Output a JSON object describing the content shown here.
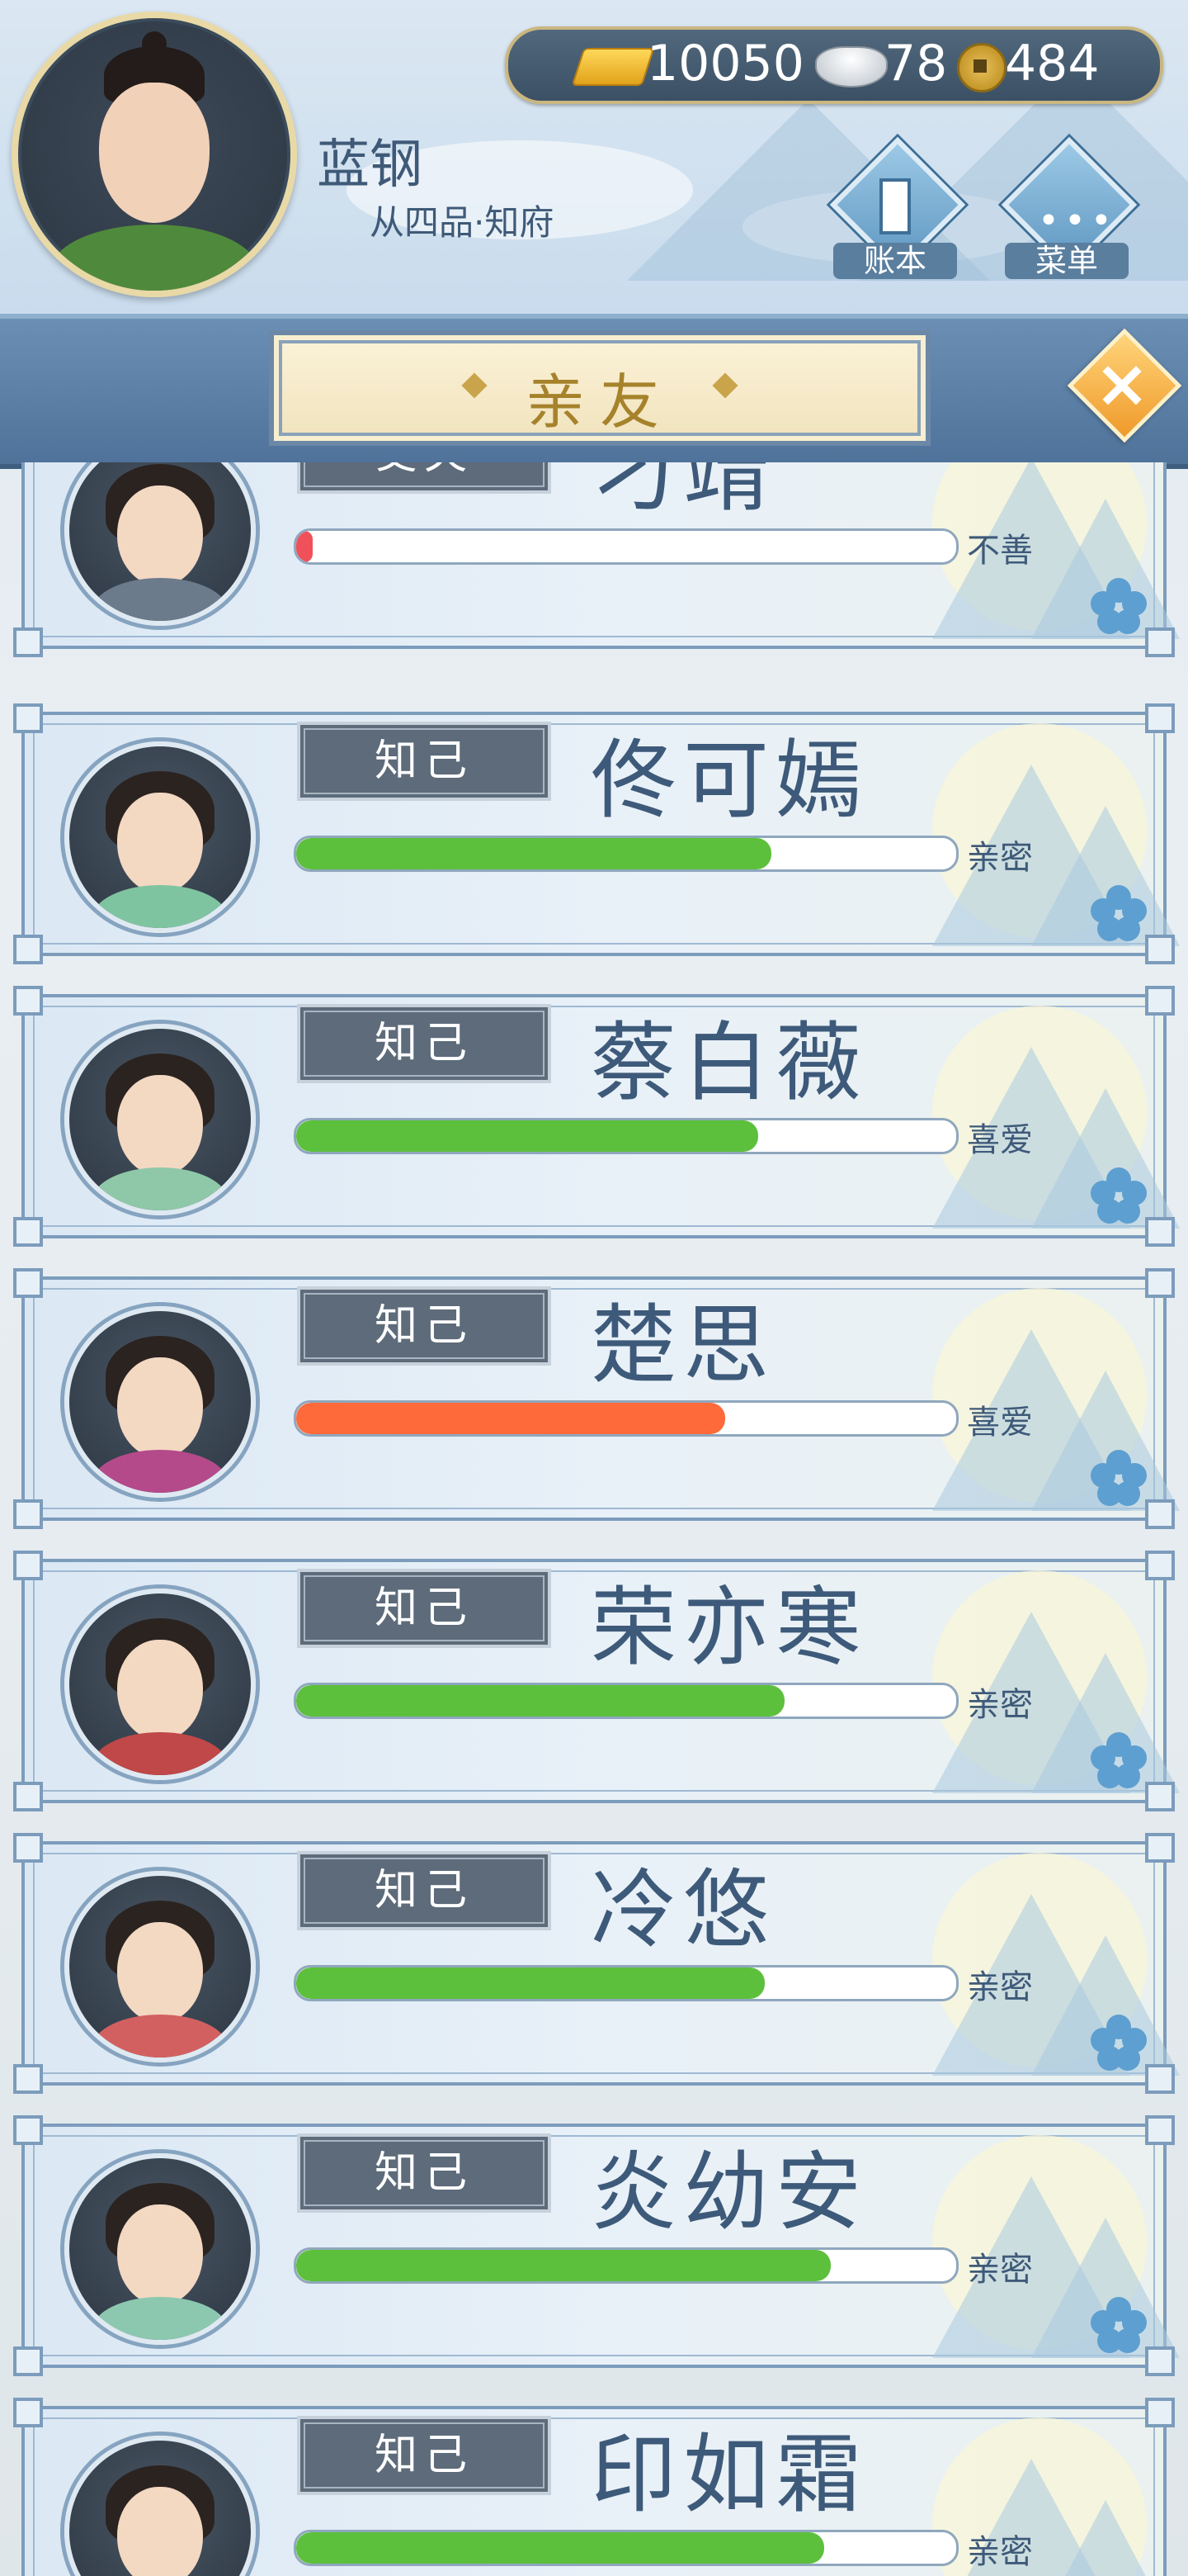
{
  "header": {
    "player_name": "蓝钢",
    "player_rank": "从四品·知府",
    "resources": {
      "gold": "10050",
      "silver": "78",
      "coins": "484"
    },
    "buttons": {
      "ledger": "账本",
      "menu": "菜单"
    }
  },
  "title": "亲友",
  "friends": [
    {
      "relation": "丈夫",
      "name": "刁靖",
      "status": "不善",
      "affinity": 0.02,
      "bar_color": "#f0505a",
      "robe_color": "#6c7b8c"
    },
    {
      "relation": "知己",
      "name": "佟可嫣",
      "status": "亲密",
      "affinity": 0.72,
      "bar_color": "#5cc03c",
      "robe_color": "#7fc4a0"
    },
    {
      "relation": "知己",
      "name": "蔡白薇",
      "status": "喜爱",
      "affinity": 0.7,
      "bar_color": "#5cc03c",
      "robe_color": "#8fc8a8"
    },
    {
      "relation": "知己",
      "name": "楚思",
      "status": "喜爱",
      "affinity": 0.65,
      "bar_color": "#ff6a3a",
      "robe_color": "#b44a8a"
    },
    {
      "relation": "知己",
      "name": "荣亦寒",
      "status": "亲密",
      "affinity": 0.74,
      "bar_color": "#5cc03c",
      "robe_color": "#c04848"
    },
    {
      "relation": "知己",
      "name": "冷悠",
      "status": "亲密",
      "affinity": 0.71,
      "bar_color": "#5cc03c",
      "robe_color": "#d36060"
    },
    {
      "relation": "知己",
      "name": "炎幼安",
      "status": "亲密",
      "affinity": 0.81,
      "bar_color": "#5cc03c",
      "robe_color": "#8cc8b0"
    },
    {
      "relation": "知己",
      "name": "印如霜",
      "status": "亲密",
      "affinity": 0.8,
      "bar_color": "#5cc03c",
      "robe_color": "#d8b860"
    }
  ]
}
